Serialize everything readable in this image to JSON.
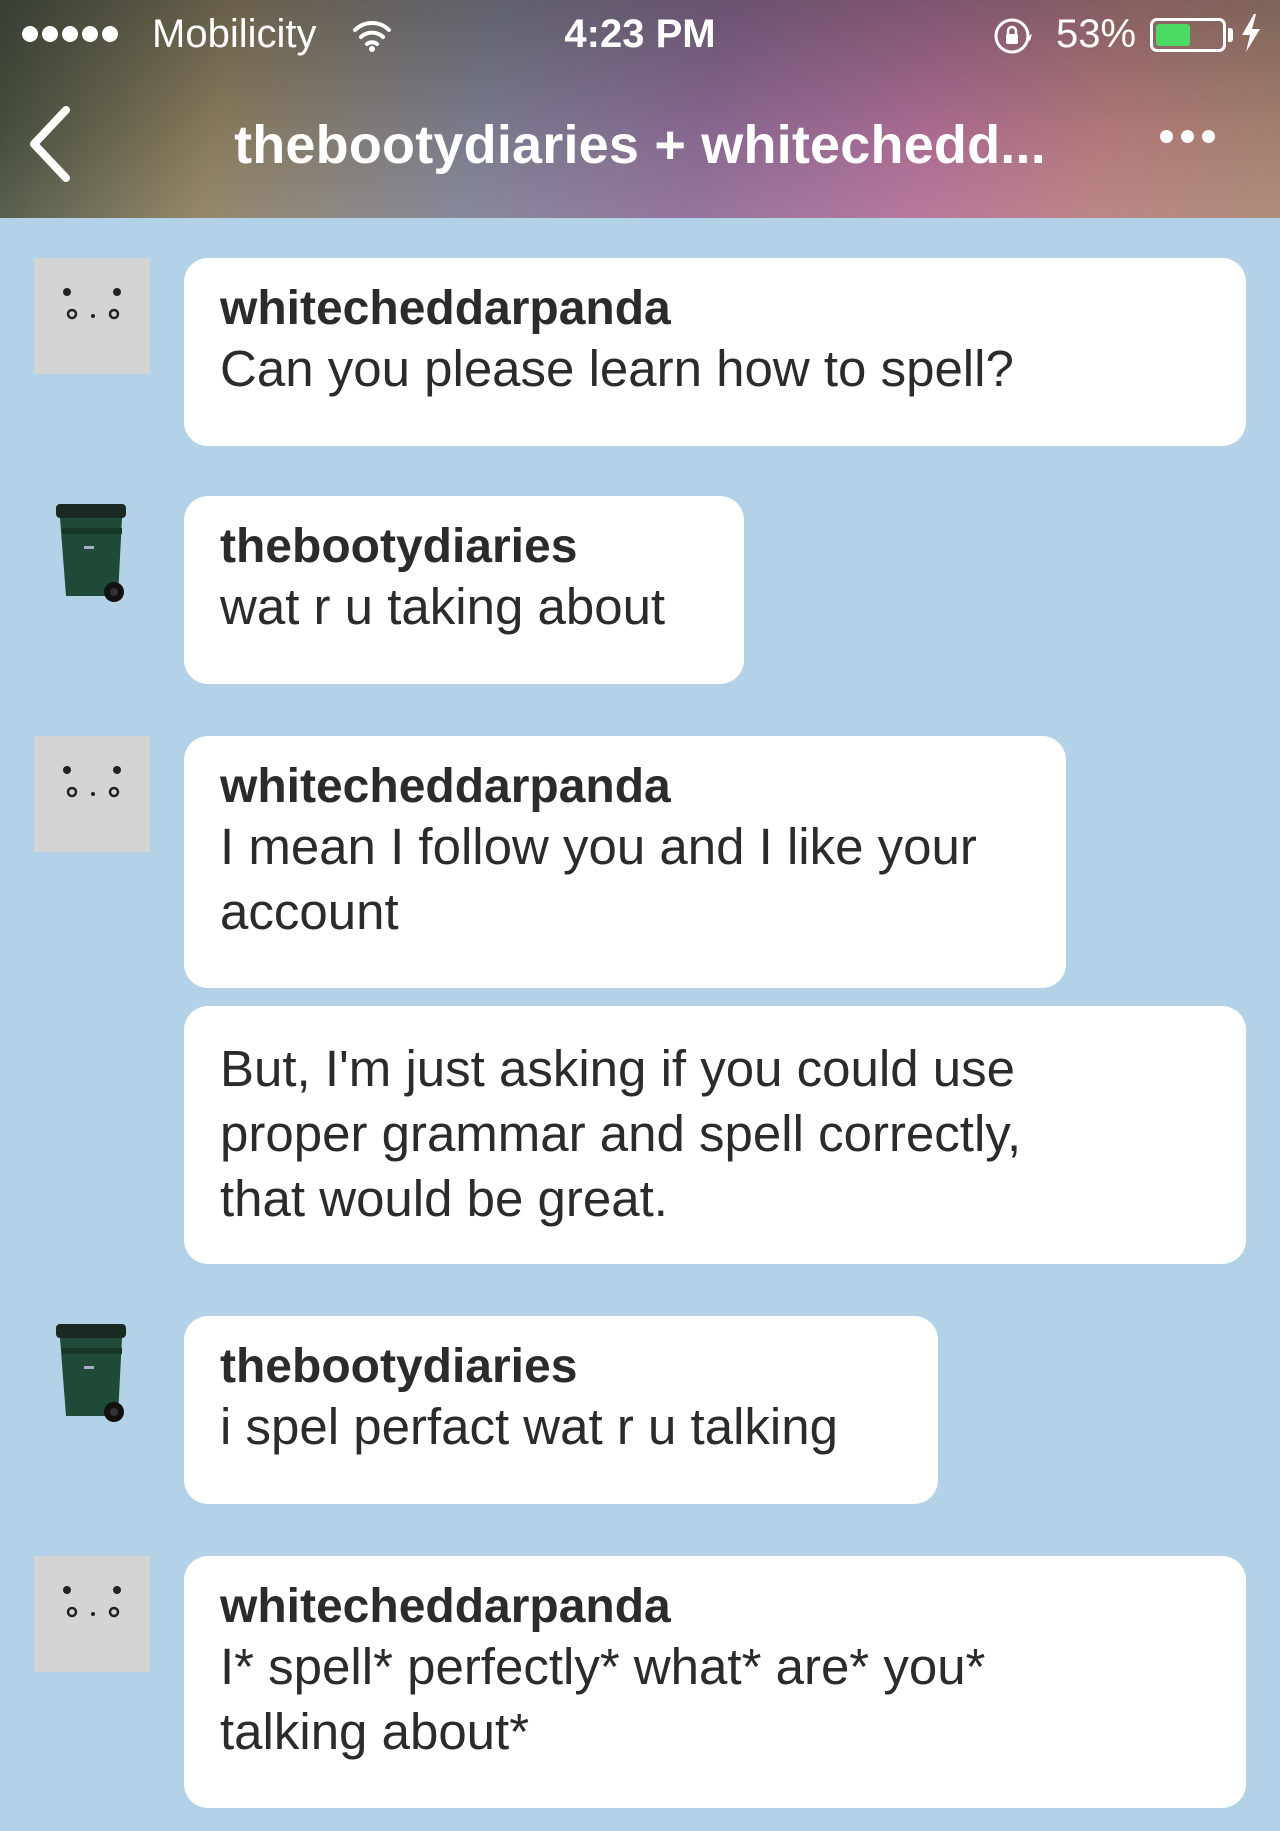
{
  "status_bar": {
    "carrier": "Mobilicity",
    "time": "4:23 PM",
    "battery_percent": "53%",
    "battery_level": 0.53,
    "battery_color": "#4cd964"
  },
  "nav": {
    "title": "thebootydiaries + whitechedd...",
    "back_icon": "chevron-left-icon",
    "more_icon": "more-horizontal-icon"
  },
  "colors": {
    "background": "#b3d2e8",
    "bubble": "#ffffff",
    "text": "#2b2b2b"
  },
  "messages": [
    {
      "author": "whitecheddarpanda",
      "avatar": "panda-face-icon",
      "text": "Can you please learn how to spell?"
    },
    {
      "author": "thebootydiaries",
      "avatar": "trash-bin-icon",
      "text": "wat r u taking about"
    },
    {
      "author": "whitecheddarpanda",
      "avatar": "panda-face-icon",
      "text_lines": [
        "I mean I follow you and I like your",
        "account"
      ]
    },
    {
      "text_lines": [
        "But, I'm just asking if you could use",
        "proper grammar and spell correctly,",
        "that would be great."
      ]
    },
    {
      "author": "thebootydiaries",
      "avatar": "trash-bin-icon",
      "text": "i spel perfact wat r u talking"
    },
    {
      "author": "whitecheddarpanda",
      "avatar": "panda-face-icon",
      "text_lines": [
        "I* spell* perfectly* what* are* you*",
        "talking about*"
      ]
    }
  ]
}
